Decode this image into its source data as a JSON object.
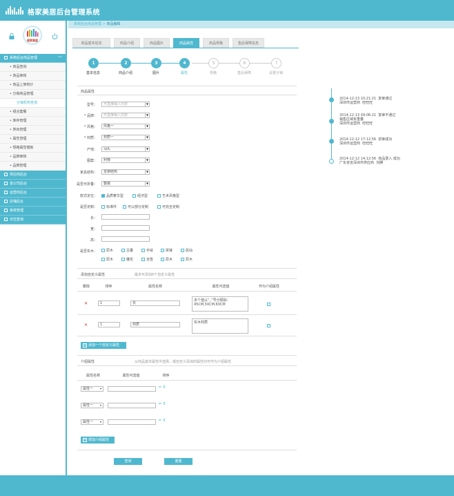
{
  "header": {
    "title": "格家美居后台管理系统"
  },
  "breadcrumb": {
    "root": "系统后台商品管理",
    "sep": " > ",
    "current": "商品编辑"
  },
  "sidebar": {
    "avatar_text": "格家美居",
    "groups": [
      {
        "label": "系统后台商品管理",
        "chevron": "﹀"
      },
      {
        "label": "供应商后台"
      },
      {
        "label": "省公司后台"
      },
      {
        "label": "运营商后台"
      },
      {
        "label": "店铺后台"
      },
      {
        "label": "系统管理"
      },
      {
        "label": "日志查询"
      }
    ],
    "items": [
      "• 商品查询",
      "• 商品审核",
      "• 商品上架统计",
      "• 分销商品管理",
      "分销机构查询",
      "• 组合套餐",
      "• 库存管理",
      "• 类目管理",
      "• 属性管理",
      "• 规格属性模板",
      "• 品牌审核",
      "• 品牌管理"
    ]
  },
  "tabs": [
    "商品基本信息",
    "商品介绍",
    "商品图片",
    "商品属性",
    "商品规格",
    "售后保障信息"
  ],
  "steps": [
    {
      "num": "1",
      "label": "基本信息"
    },
    {
      "num": "2",
      "label": "商品介绍"
    },
    {
      "num": "3",
      "label": "图片"
    },
    {
      "num": "4",
      "label": "属性"
    },
    {
      "num": "5",
      "label": "规格"
    },
    {
      "num": "6",
      "label": "售后保障"
    },
    {
      "num": "7",
      "label": "设置分销"
    }
  ],
  "attrs": {
    "section": "商品属性",
    "model_label": "型号：",
    "model_placeholder": "可直接输入内容",
    "brand_label": "* 品牌：",
    "brand_placeholder": "可直接输入内容",
    "style_label": "* 风格：",
    "style_value": "风格一",
    "material_label": "* 材质：",
    "material_value": "材质一",
    "origin_label": "产地：",
    "origin_value": "汕头",
    "pattern_label": "图案：",
    "pattern_value": "利物",
    "structure_label": "家具结构：",
    "structure_value": "支架结构",
    "foldable_label": "是否可折叠：",
    "foldable_value": "整装",
    "orient_label": "款式定位：",
    "orient_options": [
      "品质奢华型",
      "经济型",
      "艺术风格型"
    ],
    "custom_label": "是否定制：",
    "custom_options": [
      "标准件",
      "可以部分定制",
      "可完全定制"
    ],
    "length_label": "长：",
    "width_label": "宽：",
    "height_label": "高：",
    "wood_label": "是否实木：",
    "wood_row1": [
      "原木",
      "古董",
      "手绘",
      "拼接",
      "民仙"
    ],
    "wood_row2": [
      "原木",
      "雕花",
      "全签",
      "原木",
      "原木"
    ]
  },
  "custom": {
    "section": "添加自定义属性",
    "hint": "最多可添加8个自定义属性",
    "headers": [
      "删除",
      "排序",
      "属性名称",
      "属性可选值",
      "作为介绍属性"
    ],
    "rows": [
      {
        "del": "✕",
        "order": "1",
        "name": "长",
        "values": "多个值以“，”号分隔如：45CM,50CM,60CM"
      },
      {
        "del": "✕",
        "order": "1",
        "name": "材质",
        "values": "实木材质"
      }
    ],
    "add_button": "添加一个自定义属性"
  },
  "intro": {
    "section": "介绍属性",
    "hint": "从商品基本属性中选择，或自定义添加的属性均可作为介绍属性",
    "headers": [
      "属性名称",
      "属性可选值",
      "排序"
    ],
    "rows": [
      {
        "select": "属性一"
      },
      {
        "select": "属性一"
      },
      {
        "select": "属性一"
      }
    ],
    "order_glyph": "━ ⇕",
    "add_button": "增加介绍属性"
  },
  "actions": {
    "query": "查询",
    "reset": "重置"
  },
  "timeline": [
    {
      "time": "2014-12-13 10:21:21",
      "action": "复审通过",
      "org": "深圳市运营商",
      "user": "旺旺旺"
    },
    {
      "time": "2014-12-13 09:06:21",
      "action": "复审不通过",
      "org": "销售区域有重叠",
      "extra": "深圳市运营商",
      "user": "旺旺旺"
    },
    {
      "time": "2014-12-12 17:12:56",
      "action": "初审成功",
      "org": "深圳市运营商",
      "user": "旺旺旺"
    },
    {
      "time": "2014-12-12 14:12:56",
      "action": "商品录入 成功",
      "org": "广东省省深圳市供应商",
      "user": "刘腾"
    }
  ],
  "colors": {
    "accent": "#4fb8cf",
    "danger": "#dd3333"
  }
}
